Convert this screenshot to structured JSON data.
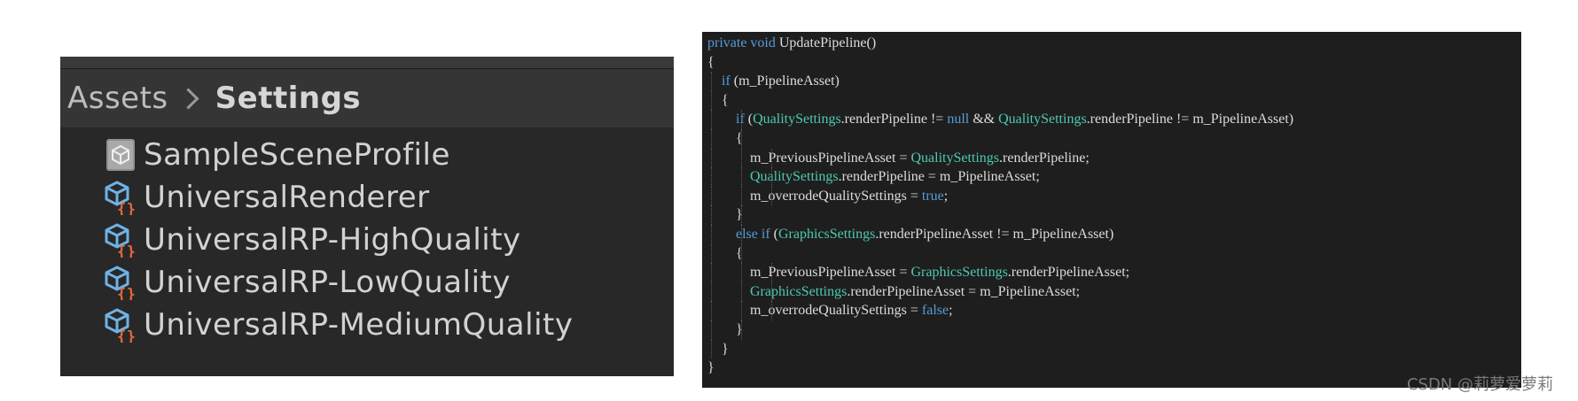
{
  "project_panel": {
    "breadcrumb": {
      "root": "Assets",
      "current": "Settings"
    },
    "assets": [
      {
        "label": "SampleSceneProfile",
        "icon": "volume-profile-icon"
      },
      {
        "label": "UniversalRenderer",
        "icon": "scriptable-object-icon"
      },
      {
        "label": "UniversalRP-HighQuality",
        "icon": "scriptable-object-icon"
      },
      {
        "label": "UniversalRP-LowQuality",
        "icon": "scriptable-object-icon"
      },
      {
        "label": "UniversalRP-MediumQuality",
        "icon": "scriptable-object-icon"
      }
    ]
  },
  "code_editor": {
    "lines": [
      [
        {
          "t": "private",
          "c": "kw"
        },
        {
          "t": " "
        },
        {
          "t": "void",
          "c": "kw"
        },
        {
          "t": " UpdatePipeline()"
        }
      ],
      [
        {
          "t": "{"
        }
      ],
      [
        {
          "t": "    "
        },
        {
          "t": "if",
          "c": "kw"
        },
        {
          "t": " (m_PipelineAsset)"
        }
      ],
      [
        {
          "t": "    {"
        }
      ],
      [
        {
          "t": "        "
        },
        {
          "t": "if",
          "c": "kw"
        },
        {
          "t": " ("
        },
        {
          "t": "QualitySettings",
          "c": "ty"
        },
        {
          "t": ".renderPipeline != "
        },
        {
          "t": "null",
          "c": "kw"
        },
        {
          "t": " && "
        },
        {
          "t": "QualitySettings",
          "c": "ty"
        },
        {
          "t": ".renderPipeline != m_PipelineAsset)"
        }
      ],
      [
        {
          "t": "        {"
        }
      ],
      [
        {
          "t": "            m_PreviousPipelineAsset = "
        },
        {
          "t": "QualitySettings",
          "c": "ty"
        },
        {
          "t": ".renderPipeline;"
        }
      ],
      [
        {
          "t": "            "
        },
        {
          "t": "QualitySettings",
          "c": "ty"
        },
        {
          "t": ".renderPipeline = m_PipelineAsset;"
        }
      ],
      [
        {
          "t": "            m_overrodeQualitySettings = "
        },
        {
          "t": "true",
          "c": "kw"
        },
        {
          "t": ";"
        }
      ],
      [
        {
          "t": "        }"
        }
      ],
      [
        {
          "t": "        "
        },
        {
          "t": "else",
          "c": "kw"
        },
        {
          "t": " "
        },
        {
          "t": "if",
          "c": "kw"
        },
        {
          "t": " ("
        },
        {
          "t": "GraphicsSettings",
          "c": "ty"
        },
        {
          "t": ".renderPipelineAsset != m_PipelineAsset)"
        }
      ],
      [
        {
          "t": "        {"
        }
      ],
      [
        {
          "t": "            m_PreviousPipelineAsset = "
        },
        {
          "t": "GraphicsSettings",
          "c": "ty"
        },
        {
          "t": ".renderPipelineAsset;"
        }
      ],
      [
        {
          "t": "            "
        },
        {
          "t": "GraphicsSettings",
          "c": "ty"
        },
        {
          "t": ".renderPipelineAsset = m_PipelineAsset;"
        }
      ],
      [
        {
          "t": "            m_overrodeQualitySettings = "
        },
        {
          "t": "false",
          "c": "kw"
        },
        {
          "t": ";"
        }
      ],
      [
        {
          "t": "        }"
        }
      ],
      [
        {
          "t": "    }"
        }
      ],
      [
        {
          "t": "}"
        }
      ]
    ],
    "colors": {
      "background": "#1e1e1e",
      "text": "#dcdcdc",
      "keyword": "#569cd6",
      "type": "#4ec9b0"
    }
  },
  "watermark": "CSDN @莉萝爱萝莉"
}
